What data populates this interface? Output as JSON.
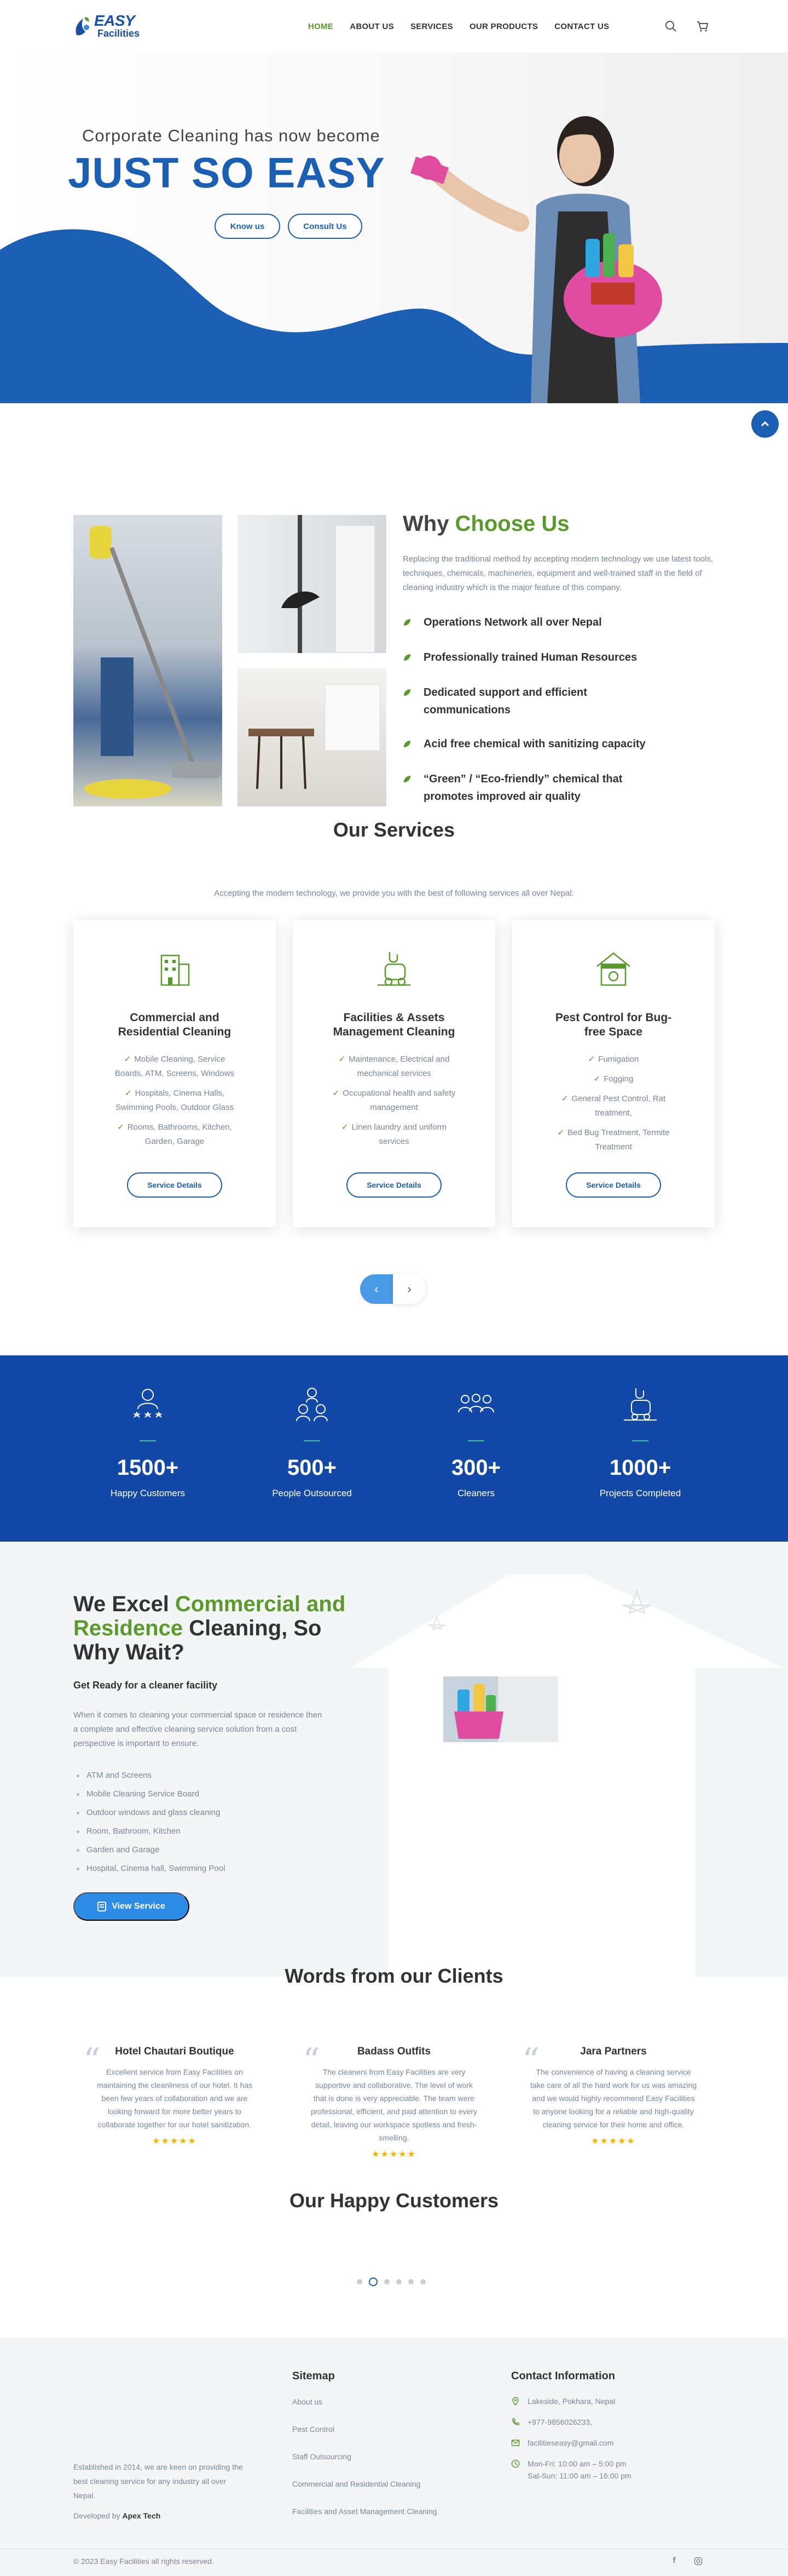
{
  "header": {
    "logo_line1": "EASY",
    "logo_line2": "Facilities",
    "nav": [
      "HOME",
      "ABOUT US",
      "SERVICES",
      "OUR PRODUCTS",
      "CONTACT US"
    ],
    "active_nav": "HOME",
    "icons": [
      "search-icon",
      "cart-icon"
    ]
  },
  "hero": {
    "subtitle": "Corporate Cleaning has now become",
    "title": "JUST SO EASY",
    "buttons": [
      "Know us",
      "Consult Us"
    ]
  },
  "why": {
    "title_plain": "Why ",
    "title_accent": "Choose Us",
    "description": "Replacing the traditional method by accepting modern technology we use latest tools, techniques, chemicals, machineries, equipment and well-trained staff in the field of cleaning industry which is the major feature of this company.",
    "points": [
      "Operations Network all over Nepal",
      "Professionally trained Human Resources",
      "Dedicated support and efficient communications",
      "Acid free chemical with sanitizing capacity",
      "“Green” / “Eco-friendly” chemical that promotes improved air quality"
    ]
  },
  "services": {
    "title": "Our Services",
    "subtitle": "Accepting the modern technology, we provide you with the best of following services all over Nepal:",
    "cards": [
      {
        "icon": "building-icon",
        "name": "Commercial and Residential Cleaning",
        "items": [
          "Mobile Cleaning, Service Boards, ATM, Screens, Windows",
          "Hospitals, Cinema Halls, Swimming Pools, Outdoor Glass",
          "Rooms, Bathrooms, Kitchen, Garden, Garage"
        ],
        "button": "Service Details"
      },
      {
        "icon": "vacuum-icon",
        "name": "Facilities & Assets Management Cleaning",
        "items": [
          "Maintenance, Electrical and mechanical services",
          "Occupational health and safety management",
          "Linen laundry and uniform services"
        ],
        "button": "Service Details"
      },
      {
        "icon": "home-shield-icon",
        "name": "Pest Control for Bug-free Space",
        "items": [
          "Fumigation",
          "Fogging",
          "General Pest Control, Rat treatment,",
          "Bed Bug Treatment, Termite Treatment"
        ],
        "button": "Service Details"
      }
    ],
    "prev": "‹",
    "next": "›"
  },
  "stats": [
    {
      "icon": "happy-customers-icon",
      "number": "1500+",
      "label": "Happy Customers"
    },
    {
      "icon": "people-outsourced-icon",
      "number": "500+",
      "label": "People Outsourced"
    },
    {
      "icon": "cleaners-icon",
      "number": "300+",
      "label": "Cleaners"
    },
    {
      "icon": "projects-icon",
      "number": "1000+",
      "label": "Projects Completed"
    }
  ],
  "excel": {
    "title_part1": "We Excel ",
    "title_accent": "Commercial and Residence",
    "title_part2": " Cleaning, So Why Wait?",
    "heading": "Get Ready for a cleaner facility",
    "description": "When it comes to cleaning your commercial space or residence then a complete and effective cleaning service solution from a cost perspective is important to ensure.",
    "list": [
      "ATM and Screens",
      "Mobile Cleaning Service Board",
      "Outdoor windows and glass cleaning",
      "Room, Bathroom, Kitchen",
      "Garden and Garage",
      "Hospital, Cinema hall, Swimming Pool"
    ],
    "button": "View Service"
  },
  "testimonials": {
    "title": "Words from our Clients",
    "items": [
      {
        "name": "Hotel Chautari Boutique",
        "text": "Excellent service from Easy Facilities on maintaining the cleanliness of our hotel. It has been few years of collaboration and we are looking forward for more better years to collaborate together for our hotel sanitization.",
        "stars": "★★★★★"
      },
      {
        "name": "Badass Outfits",
        "text": "The cleaners from Easy Facilities are very supportive and collaborative. The level of work that is done is very appreciable. The team were professional, efficient, and paid attention to every detail, leaving our workspace spotless and fresh-smelling.",
        "stars": "★★★★★"
      },
      {
        "name": "Jara Partners",
        "text": "The convenience of having a cleaning service take care of all the hard work for us was amazing and we would highly recommend Easy Facilities to anyone looking for a reliable and high-quality cleaning service for their home and office.",
        "stars": "★★★★★"
      }
    ]
  },
  "customers": {
    "title": "Our Happy Customers",
    "dots": 6,
    "active_dot": 2
  },
  "footer": {
    "about": "Established in 2014, we are keen on providing the best cleaning service for any industry all over Nepal.",
    "developed_prefix": "Developed by ",
    "developer": "Apex Tech",
    "sitemap_title": "Sitemap",
    "sitemap": [
      "About us",
      "Pest Control",
      "Staff Outsourcing",
      "Commercial and Residential Cleaning",
      "Facilities and Asset Management Cleaning"
    ],
    "contact_title": "Contact Information",
    "address": "Lakeside, Pokhara, Nepal",
    "phone": "+977-9856026233,",
    "email": "facilitieseasy@gmail.com",
    "hours1": "Mon-Fri: 10:00 am – 5:00 pm",
    "hours2": "Sat-Sun: 11:00 am – 16:00 pm",
    "copyright": "© 2023 Easy Facilities all rights reserved.",
    "social": [
      "facebook-icon",
      "instagram-icon"
    ]
  },
  "colors": {
    "primary": "#1a5fb4",
    "accent": "#5a9a2c",
    "stats_bg": "#1249a8"
  }
}
